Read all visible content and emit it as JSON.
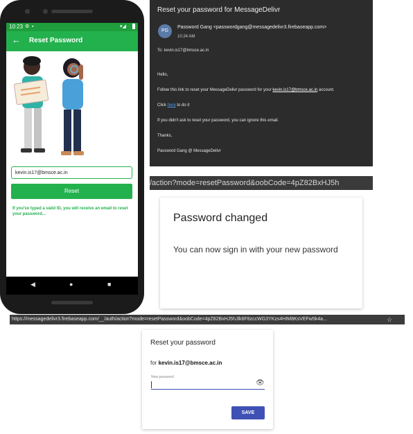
{
  "phone": {
    "status_time": "10:23",
    "appbar_title": "Reset Password",
    "email_value": "kevin.is17@bmsce.ac.in",
    "reset_label": "Reset",
    "hint": "If you've typed a valid ID, you will receive an email to reset your password...",
    "nav": {
      "back": "◀",
      "home": "●",
      "recent": "■"
    },
    "colors": {
      "primary": "#23b14d",
      "status": "#1e9e3c"
    }
  },
  "email": {
    "subject": "Reset your password for MessageDelivr",
    "avatar_initials": "PG",
    "sender": "Password Gang <passwordgang@messagedelivr3.firebaseapp.com>",
    "time": "10:24 AM",
    "to": "To: kevin.is17@bmsce.ac.in",
    "greeting": "Hello,",
    "line1_pre": "Follow this link to reset your MessageDelivr password for your ",
    "line1_account": "kevin.is17@bmsce.ac.in",
    "line1_post": " account.",
    "line2_pre": "Click ",
    "line2_link": "here",
    "line2_post": " to do it",
    "line3": "If you didn't ask to reset your password, you can ignore this email.",
    "thanks": "Thanks,",
    "signature": "Password Gang @ MessageDelivr"
  },
  "url_strip": "/action?mode=resetPassword&oobCode=4pZ82BxHJ5h",
  "changed_card": {
    "title": "Password changed",
    "message": "You can now sign in with your new password"
  },
  "browser": {
    "url": "https://messagedelivr3.firebaseapp.com/__/auth/action?mode=resetPassword&oobCode=4pZ82BxHJ5hJlk6F8zccWG3YKzs4HIM8KsVEFw5k4a..."
  },
  "reset_card": {
    "title": "Reset your password",
    "for_prefix": "for ",
    "for_email": "kevin.is17@bmsce.ac.in",
    "field_label": "New password",
    "save_label": "SAVE"
  }
}
